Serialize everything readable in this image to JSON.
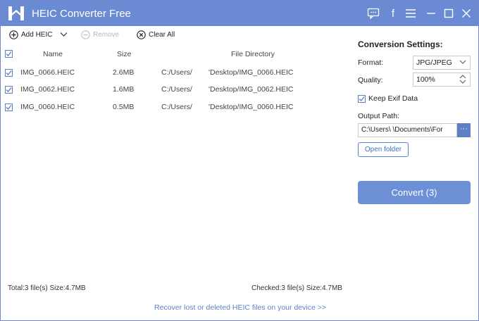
{
  "colors": {
    "titlebar": "#6a8bd3",
    "accent": "#5c7fc6",
    "link": "#5a82c4"
  },
  "window": {
    "title": "HEIC Converter Free",
    "controls": [
      "feedback-icon",
      "facebook-icon",
      "menu-icon",
      "minimize-icon",
      "maximize-icon",
      "close-icon"
    ],
    "facebook_glyph": "f"
  },
  "toolbar": {
    "add_label": "Add HEIC",
    "remove_label": "Remove",
    "clear_label": "Clear All"
  },
  "table": {
    "headers": {
      "name": "Name",
      "size": "Size",
      "directory": "File Directory"
    },
    "rows": [
      {
        "name": "IMG_0066.HEIC",
        "size": "2.6MB",
        "dir_prefix": "C:/Users/",
        "dir_suffix": "'Desktop/IMG_0066.HEIC",
        "checked": true
      },
      {
        "name": "IMG_0062.HEIC",
        "size": "1.6MB",
        "dir_prefix": "C:/Users/",
        "dir_suffix": "'Desktop/IMG_0062.HEIC",
        "checked": true
      },
      {
        "name": "IMG_0060.HEIC",
        "size": "0.5MB",
        "dir_prefix": "C:/Users/",
        "dir_suffix": "'Desktop/IMG_0060.HEIC",
        "checked": true
      }
    ]
  },
  "settings": {
    "title": "Conversion Settings:",
    "format_label": "Format:",
    "format_value": "JPG/JPEG",
    "quality_label": "Quality:",
    "quality_value": "100%",
    "keep_exif_label": "Keep Exif Data",
    "keep_exif_checked": true,
    "output_path_label": "Output Path:",
    "output_path_value": "C:\\Users\\        \\Documents\\For",
    "browse_label": "···",
    "open_folder_label": "Open folder",
    "convert_label": "Convert (3)"
  },
  "status": {
    "total": "Total:3 file(s) Size:4.7MB",
    "checked": "Checked:3 file(s) Size:4.7MB"
  },
  "recover_link": "Recover lost or deleted HEIC files on your device >>"
}
